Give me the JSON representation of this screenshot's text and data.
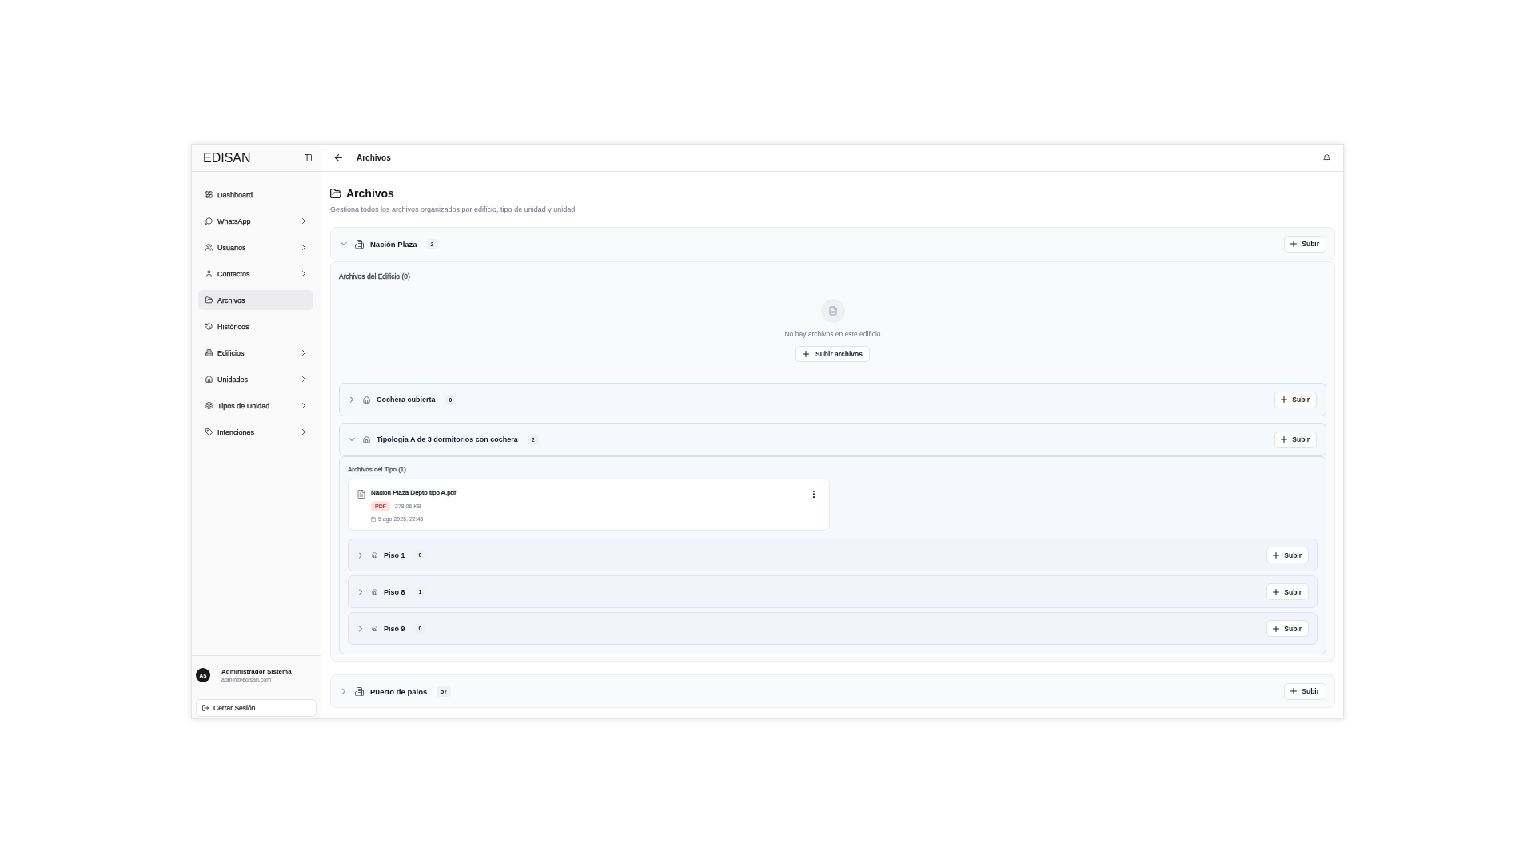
{
  "sidebar": {
    "logo": "EDISAN",
    "items": [
      {
        "label": "Dashboard",
        "has_submenu": false,
        "selected": false
      },
      {
        "label": "WhatsApp",
        "has_submenu": true,
        "selected": false
      },
      {
        "label": "Usuarios",
        "has_submenu": true,
        "selected": false
      },
      {
        "label": "Contactos",
        "has_submenu": true,
        "selected": false
      },
      {
        "label": "Archivos",
        "has_submenu": false,
        "selected": true
      },
      {
        "label": "Históricos",
        "has_submenu": false,
        "selected": false
      },
      {
        "label": "Edificios",
        "has_submenu": true,
        "selected": false
      },
      {
        "label": "Unidades",
        "has_submenu": true,
        "selected": false
      },
      {
        "label": "Tipos de Unidad",
        "has_submenu": true,
        "selected": false
      },
      {
        "label": "Intenciones",
        "has_submenu": true,
        "selected": false
      }
    ],
    "user": {
      "initials": "AS",
      "name": "Administrador Sistema",
      "email": "admin@edisan.com"
    },
    "logout_button": "Cerrar Sesión"
  },
  "header": {
    "title": "Archivos"
  },
  "page": {
    "title": "Archivos",
    "subtitle": "Gestiona todos los archivos organizados por edificio, tipo de unidad y unidad"
  },
  "buildings": [
    {
      "name": "Nación Plaza",
      "count": "2",
      "expanded": true,
      "upload_button": "Subir",
      "files_title": "Archivos del Edificio (0)",
      "empty_text": "No hay archivos en este edificio",
      "empty_button": "Subir archivos",
      "unit_types": [
        {
          "name": "Cochera cubierta",
          "count": "0",
          "expanded": false,
          "upload_button": "Subir"
        },
        {
          "name": "Tipologia A de 3 dormitorios con cochera",
          "count": "2",
          "expanded": true,
          "upload_button": "Subir",
          "files_title": "Archivos del Tipo (1)",
          "files": [
            {
              "name": "Nacion Plaza Depto tipo A.pdf",
              "type": "PDF",
              "size": "278.06 KB",
              "date": "5 ago 2025, 22:46"
            }
          ],
          "units": [
            {
              "name": "Piso 1",
              "count": "0",
              "expanded": false,
              "upload_button": "Subir"
            },
            {
              "name": "Piso 8",
              "count": "1",
              "expanded": false,
              "upload_button": "Subir"
            },
            {
              "name": "Piso 9",
              "count": "0",
              "expanded": false,
              "upload_button": "Subir"
            }
          ]
        }
      ]
    },
    {
      "name": "Puerto de palos",
      "count": "57",
      "expanded": false,
      "upload_button": "Subir"
    }
  ]
}
